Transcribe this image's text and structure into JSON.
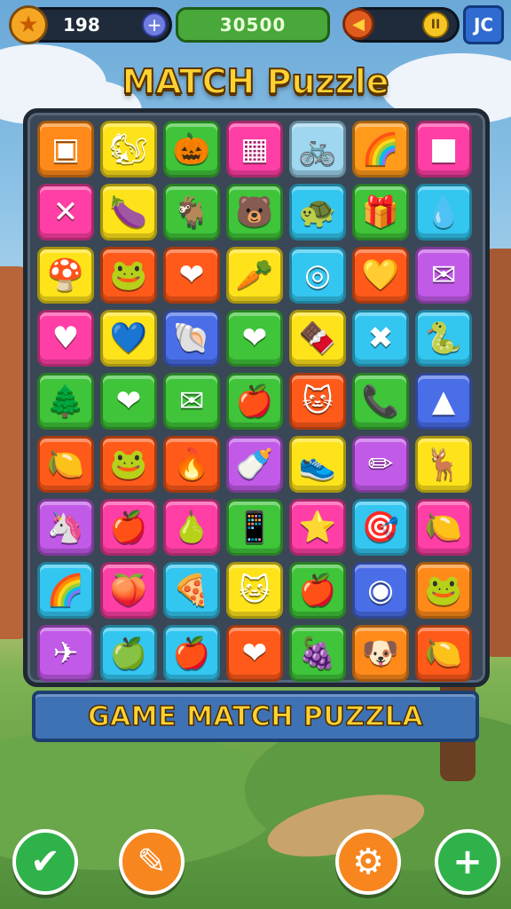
{
  "topbar": {
    "coins": "198",
    "score": "30500",
    "right_button": "JC",
    "colors": {
      "coin": "#f5a623",
      "score_bg": "#48a83a",
      "button": "#2f6bd0"
    }
  },
  "title": "MATCH Puzzle",
  "banner": "GAME MATCH PUZZLA",
  "board": {
    "rows": [
      [
        {
          "c": "#ff8a1a",
          "i": "▣"
        },
        {
          "c": "#ffe31a",
          "i": "🐿"
        },
        {
          "c": "#3fc43a",
          "i": "🎃"
        },
        {
          "c": "#ff3fa5",
          "i": "▦"
        },
        {
          "c": "#9fd6f0",
          "i": "🚲"
        },
        {
          "c": "#ff9a1a",
          "i": "🌈"
        },
        {
          "c": "#ff3fa5",
          "i": "■"
        }
      ],
      [
        {
          "c": "#ff3fa5",
          "i": "✕"
        },
        {
          "c": "#ffe31a",
          "i": "🍆"
        },
        {
          "c": "#3fc43a",
          "i": "🐐"
        },
        {
          "c": "#3fc43a",
          "i": "🐻"
        },
        {
          "c": "#33c6f0",
          "i": "🐢"
        },
        {
          "c": "#3fc43a",
          "i": "🎁"
        },
        {
          "c": "#33c6f0",
          "i": "💧"
        }
      ],
      [
        {
          "c": "#ffe31a",
          "i": "🍄"
        },
        {
          "c": "#ff5a1a",
          "i": "🐸"
        },
        {
          "c": "#ff5a1a",
          "i": "❤"
        },
        {
          "c": "#ffe31a",
          "i": "🥕"
        },
        {
          "c": "#33c6f0",
          "i": "◎"
        },
        {
          "c": "#ff5a1a",
          "i": "💛"
        },
        {
          "c": "#c25ae8",
          "i": "✉"
        }
      ],
      [
        {
          "c": "#ff3fa5",
          "i": "♥"
        },
        {
          "c": "#ffe31a",
          "i": "💙"
        },
        {
          "c": "#4a6ee8",
          "i": "🐚"
        },
        {
          "c": "#3fc43a",
          "i": "❤"
        },
        {
          "c": "#ffe31a",
          "i": "🍫"
        },
        {
          "c": "#33c6f0",
          "i": "✖"
        },
        {
          "c": "#33c6f0",
          "i": "🐍"
        }
      ],
      [
        {
          "c": "#3fc43a",
          "i": "🌲"
        },
        {
          "c": "#3fc43a",
          "i": "❤"
        },
        {
          "c": "#3fc43a",
          "i": "✉"
        },
        {
          "c": "#3fc43a",
          "i": "🍎"
        },
        {
          "c": "#ff5a1a",
          "i": "🐱"
        },
        {
          "c": "#3fc43a",
          "i": "📞"
        },
        {
          "c": "#4a6ee8",
          "i": "▲"
        }
      ],
      [
        {
          "c": "#ff5a1a",
          "i": "🍋"
        },
        {
          "c": "#ff5a1a",
          "i": "🐸"
        },
        {
          "c": "#ff5a1a",
          "i": "🔥"
        },
        {
          "c": "#c25ae8",
          "i": "🍼"
        },
        {
          "c": "#ffe31a",
          "i": "👟"
        },
        {
          "c": "#c25ae8",
          "i": "✏"
        },
        {
          "c": "#ffe31a",
          "i": "🦌"
        }
      ],
      [
        {
          "c": "#c25ae8",
          "i": "🦄"
        },
        {
          "c": "#ff3fa5",
          "i": "🍎"
        },
        {
          "c": "#ff3fa5",
          "i": "🍐"
        },
        {
          "c": "#3fc43a",
          "i": "📱"
        },
        {
          "c": "#ff3fa5",
          "i": "⭐"
        },
        {
          "c": "#33c6f0",
          "i": "🎯"
        },
        {
          "c": "#ff3fa5",
          "i": "🍋"
        }
      ],
      [
        {
          "c": "#33c6f0",
          "i": "🌈"
        },
        {
          "c": "#ff3fa5",
          "i": "🍑"
        },
        {
          "c": "#33c6f0",
          "i": "🍕"
        },
        {
          "c": "#ffe31a",
          "i": "🐱"
        },
        {
          "c": "#3fc43a",
          "i": "🍎"
        },
        {
          "c": "#4a6ee8",
          "i": "◉"
        },
        {
          "c": "#ff8a1a",
          "i": "🐸"
        }
      ],
      [
        {
          "c": "#c25ae8",
          "i": "✈"
        },
        {
          "c": "#33c6f0",
          "i": "🍏"
        },
        {
          "c": "#33c6f0",
          "i": "🍎"
        },
        {
          "c": "#ff5a1a",
          "i": "❤"
        },
        {
          "c": "#3fc43a",
          "i": "🍇"
        },
        {
          "c": "#ff8a1a",
          "i": "🐶"
        },
        {
          "c": "#ff5a1a",
          "i": "🍋"
        }
      ]
    ]
  },
  "bottom_buttons": [
    {
      "name": "confirm-button",
      "icon": "✔",
      "color": "#2fb24a"
    },
    {
      "name": "hint-button",
      "icon": "✎",
      "color": "#f7861f"
    },
    {
      "name": "settings-button",
      "icon": "⚙",
      "color": "#f7861f"
    },
    {
      "name": "add-button",
      "icon": "+",
      "color": "#2fb24a"
    }
  ]
}
